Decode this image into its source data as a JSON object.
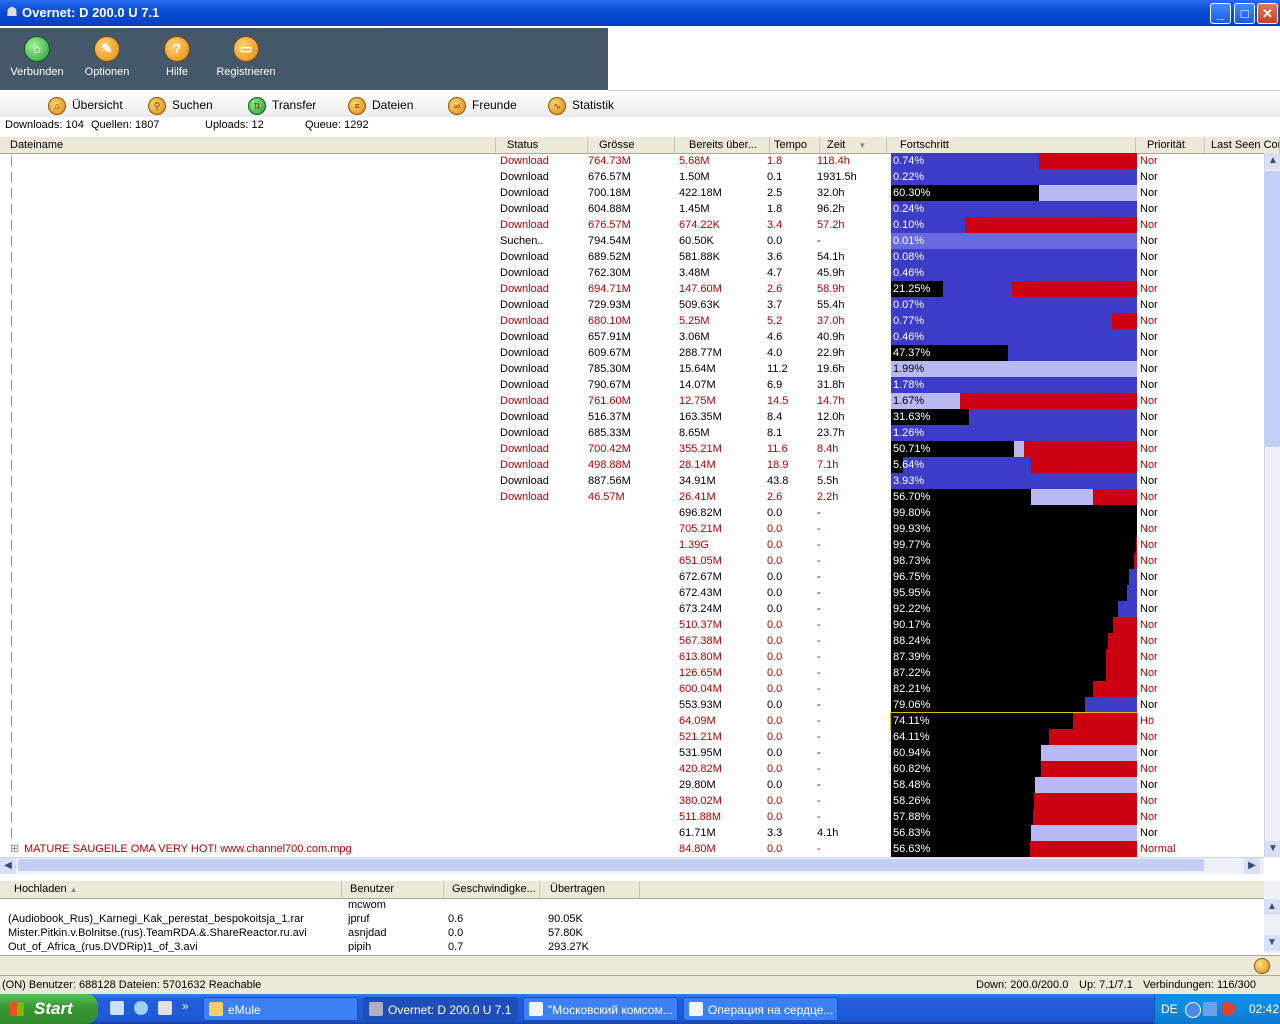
{
  "window": {
    "title": "Overnet: D 200.0 U 7.1"
  },
  "toolbar": [
    {
      "label": "Verbunden",
      "icon": "network-icon"
    },
    {
      "label": "Optionen",
      "icon": "wrench-icon"
    },
    {
      "label": "Hilfe",
      "icon": "help-icon"
    },
    {
      "label": "Registrieren",
      "icon": "register-icon"
    }
  ],
  "nav": [
    {
      "label": "Übersicht",
      "icon": "home-icon"
    },
    {
      "label": "Suchen",
      "icon": "search-icon"
    },
    {
      "label": "Transfer",
      "icon": "transfer-icon"
    },
    {
      "label": "Dateien",
      "icon": "files-icon"
    },
    {
      "label": "Freunde",
      "icon": "friends-icon"
    },
    {
      "label": "Statistik",
      "icon": "statistics-icon"
    }
  ],
  "stats": {
    "downloads": "Downloads: 104",
    "sources": "Quellen: 1807",
    "uploads": "Uploads: 12",
    "queue": "Queue: 1292"
  },
  "download_columns": [
    "Dateiname",
    "Status",
    "Grösse",
    "Bereits über...",
    "Tempo",
    "Zeit",
    "Fortschritt",
    "Priorität",
    "Last Seen Com"
  ],
  "downloads": [
    {
      "status": "Download",
      "size": "764.73M",
      "done": "5.68M",
      "speed": "1.8",
      "time": "118.4h",
      "pct": "0.74%",
      "prio": "Nor",
      "red": true
    },
    {
      "status": "Download",
      "size": "676.57M",
      "done": "1.50M",
      "speed": "0.1",
      "time": "1931.5h",
      "pct": "0.22%",
      "prio": "Nor",
      "red": false
    },
    {
      "status": "Download",
      "size": "700.18M",
      "done": "422.18M",
      "speed": "2.5",
      "time": "32.0h",
      "pct": "60.30%",
      "prio": "Nor",
      "red": false
    },
    {
      "status": "Download",
      "size": "604.88M",
      "done": "1.45M",
      "speed": "1.8",
      "time": "96.2h",
      "pct": "0.24%",
      "prio": "Nor",
      "red": false
    },
    {
      "status": "Download",
      "size": "676.57M",
      "done": "674.22K",
      "speed": "3.4",
      "time": "57.2h",
      "pct": "0.10%",
      "prio": "Nor",
      "red": true
    },
    {
      "status": "Suchen..",
      "size": "794.54M",
      "done": "60.50K",
      "speed": "0.0",
      "time": "-",
      "pct": "0.01%",
      "prio": "Nor",
      "red": false
    },
    {
      "status": "Download",
      "size": "689.52M",
      "done": "581.88K",
      "speed": "3.6",
      "time": "54.1h",
      "pct": "0.08%",
      "prio": "Nor",
      "red": false
    },
    {
      "status": "Download",
      "size": "762.30M",
      "done": "3.48M",
      "speed": "4.7",
      "time": "45.9h",
      "pct": "0.46%",
      "prio": "Nor",
      "red": false
    },
    {
      "status": "Download",
      "size": "694.71M",
      "done": "147.60M",
      "speed": "2.6",
      "time": "58.9h",
      "pct": "21.25%",
      "prio": "Nor",
      "red": true
    },
    {
      "status": "Download",
      "size": "729.93M",
      "done": "509.63K",
      "speed": "3.7",
      "time": "55.4h",
      "pct": "0.07%",
      "prio": "Nor",
      "red": false
    },
    {
      "status": "Download",
      "size": "680.10M",
      "done": "5.25M",
      "speed": "5.2",
      "time": "37.0h",
      "pct": "0.77%",
      "prio": "Nor",
      "red": true
    },
    {
      "status": "Download",
      "size": "657.91M",
      "done": "3.06M",
      "speed": "4.6",
      "time": "40.9h",
      "pct": "0.46%",
      "prio": "Nor",
      "red": false
    },
    {
      "status": "Download",
      "size": "609.67M",
      "done": "288.77M",
      "speed": "4.0",
      "time": "22.9h",
      "pct": "47.37%",
      "prio": "Nor",
      "red": false
    },
    {
      "status": "Download",
      "size": "785.30M",
      "done": "15.64M",
      "speed": "11.2",
      "time": "19.6h",
      "pct": "1.99%",
      "prio": "Nor",
      "red": false
    },
    {
      "status": "Download",
      "size": "790.67M",
      "done": "14.07M",
      "speed": "6.9",
      "time": "31.8h",
      "pct": "1.78%",
      "prio": "Nor",
      "red": false
    },
    {
      "status": "Download",
      "size": "761.60M",
      "done": "12.75M",
      "speed": "14.5",
      "time": "14.7h",
      "pct": "1.67%",
      "prio": "Nor",
      "red": true
    },
    {
      "status": "Download",
      "size": "516.37M",
      "done": "163.35M",
      "speed": "8.4",
      "time": "12.0h",
      "pct": "31.63%",
      "prio": "Nor",
      "red": false
    },
    {
      "status": "Download",
      "size": "685.33M",
      "done": "8.65M",
      "speed": "8.1",
      "time": "23.7h",
      "pct": "1.26%",
      "prio": "Nor",
      "red": false
    },
    {
      "status": "Download",
      "size": "700.42M",
      "done": "355.21M",
      "speed": "11.6",
      "time": "8.4h",
      "pct": "50.71%",
      "prio": "Nor",
      "red": true
    },
    {
      "status": "Download",
      "size": "498.88M",
      "done": "28.14M",
      "speed": "18.9",
      "time": "7.1h",
      "pct": "5.64%",
      "prio": "Nor",
      "red": true
    },
    {
      "status": "Download",
      "size": "887.56M",
      "done": "34.91M",
      "speed": "43.8",
      "time": "5.5h",
      "pct": "3.93%",
      "prio": "Nor",
      "red": false
    },
    {
      "status": "Download",
      "size": "46.57M",
      "done": "26.41M",
      "speed": "2.6",
      "time": "2.2h",
      "pct": "56.70%",
      "prio": "Nor",
      "red": true
    },
    {
      "status": "",
      "size": "",
      "done": "696.82M",
      "speed": "0.0",
      "time": "-",
      "pct": "99.80%",
      "prio": "Nor",
      "red": false
    },
    {
      "status": "",
      "size": "",
      "done": "705.21M",
      "speed": "0.0",
      "time": "-",
      "pct": "99.93%",
      "prio": "Nor",
      "red": true
    },
    {
      "status": "",
      "size": "",
      "done": "1.39G",
      "speed": "0.0",
      "time": "-",
      "pct": "99.77%",
      "prio": "Nor",
      "red": true
    },
    {
      "status": "",
      "size": "",
      "done": "651.05M",
      "speed": "0.0",
      "time": "-",
      "pct": "98.73%",
      "prio": "Nor",
      "red": true
    },
    {
      "status": "",
      "size": "",
      "done": "672.67M",
      "speed": "0.0",
      "time": "-",
      "pct": "96.75%",
      "prio": "Nor",
      "red": false
    },
    {
      "status": "",
      "size": "",
      "done": "672.43M",
      "speed": "0.0",
      "time": "-",
      "pct": "95.95%",
      "prio": "Nor",
      "red": false
    },
    {
      "status": "",
      "size": "",
      "done": "673.24M",
      "speed": "0.0",
      "time": "-",
      "pct": "92.22%",
      "prio": "Nor",
      "red": false
    },
    {
      "status": "",
      "size": "",
      "done": "510.37M",
      "speed": "0.0",
      "time": "-",
      "pct": "90.17%",
      "prio": "Nor",
      "red": true
    },
    {
      "status": "",
      "size": "",
      "done": "567.38M",
      "speed": "0.0",
      "time": "-",
      "pct": "88.24%",
      "prio": "Nor",
      "red": true
    },
    {
      "status": "",
      "size": "",
      "done": "613.80M",
      "speed": "0.0",
      "time": "-",
      "pct": "87.39%",
      "prio": "Nor",
      "red": true
    },
    {
      "status": "",
      "size": "",
      "done": "126.65M",
      "speed": "0.0",
      "time": "-",
      "pct": "87.22%",
      "prio": "Nor",
      "red": true
    },
    {
      "status": "",
      "size": "",
      "done": "600.04M",
      "speed": "0.0",
      "time": "-",
      "pct": "82.21%",
      "prio": "Nor",
      "red": true
    },
    {
      "status": "",
      "size": "",
      "done": "553.93M",
      "speed": "0.0",
      "time": "-",
      "pct": "79.06%",
      "prio": "Nor",
      "red": false
    },
    {
      "status": "",
      "size": "",
      "done": "64.09M",
      "speed": "0.0",
      "time": "-",
      "pct": "74.11%",
      "prio": "Hö",
      "red": true
    },
    {
      "status": "",
      "size": "",
      "done": "521.21M",
      "speed": "0.0",
      "time": "-",
      "pct": "64.11%",
      "prio": "Nor",
      "red": true
    },
    {
      "status": "",
      "size": "",
      "done": "531.95M",
      "speed": "0.0",
      "time": "-",
      "pct": "60.94%",
      "prio": "Nor",
      "red": false
    },
    {
      "status": "",
      "size": "",
      "done": "420.82M",
      "speed": "0.0",
      "time": "-",
      "pct": "60.82%",
      "prio": "Nor",
      "red": true
    },
    {
      "status": "",
      "size": "",
      "done": "29.80M",
      "speed": "0.0",
      "time": "-",
      "pct": "58.48%",
      "prio": "Nor",
      "red": false
    },
    {
      "status": "",
      "size": "",
      "done": "380.02M",
      "speed": "0.0",
      "time": "-",
      "pct": "58.26%",
      "prio": "Nor",
      "red": true
    },
    {
      "status": "",
      "size": "",
      "done": "511.88M",
      "speed": "0.0",
      "time": "-",
      "pct": "57.88%",
      "prio": "Nor",
      "red": true
    },
    {
      "status": "",
      "size": "",
      "done": "61.71M",
      "speed": "3.3",
      "time": "4.1h",
      "pct": "56.83%",
      "prio": "Nor",
      "red": false
    },
    {
      "status": "",
      "size": "",
      "done": "84.80M",
      "speed": "0.0",
      "time": "-",
      "pct": "56.63%",
      "prio": "Normal",
      "red": true,
      "name": "MATURE  SAUGEILE OMA   VERY HOT! www.channel700.com.mpg"
    }
  ],
  "upload_columns": [
    "Hochladen",
    "Benutzer",
    "Geschwindigke...",
    "Übertragen"
  ],
  "uploads": [
    {
      "file": "",
      "user": "mcwom",
      "speed": "",
      "transferred": ""
    },
    {
      "file": "(Audiobook_Rus)_Karnegi_Kak_perestat_bespokoitsja_1.rar",
      "user": "jpruf",
      "speed": "0.6",
      "transferred": "90.05K"
    },
    {
      "file": "Mister.Pitkin.v.Bolnitse.(rus).TeamRDA.&.ShareReactor.ru.avi",
      "user": "asnjdad",
      "speed": "0.0",
      "transferred": "57.80K"
    },
    {
      "file": "Out_of_Africa_(rus.DVDRip)1_of_3.avi",
      "user": "pipih",
      "speed": "0.7",
      "transferred": "293.27K"
    }
  ],
  "statusbar": {
    "left": "(ON) Benutzer: 688128 Dateien: 5701632 Reachable",
    "down": "Down: 200.0/200.0",
    "up": "Up: 7.1/7.1",
    "conn": "Verbindungen: 116/300"
  },
  "taskbar": {
    "start": "Start",
    "tasks": [
      "eMule",
      "Overnet: D 200.0 U 7.1",
      "\"Московский комсом...",
      "Операция на сердце..."
    ],
    "lang": "DE",
    "clock": "02:42"
  },
  "colors": {
    "blue": "#3c3cc8",
    "lightblue": "#b8b8f4",
    "red": "#cc0010",
    "black": "#000000",
    "toolbar": "#44586c"
  }
}
